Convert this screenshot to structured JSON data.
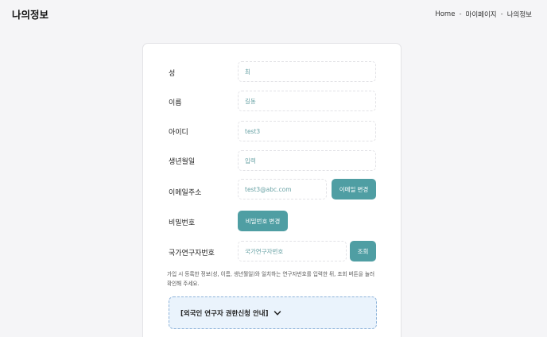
{
  "header": {
    "title": "나의정보",
    "breadcrumb": [
      "Home",
      "마이페이지",
      "나의정보"
    ],
    "separator": "-"
  },
  "form": {
    "rows": [
      {
        "label": "성",
        "value": "최"
      },
      {
        "label": "이름",
        "value": "길동"
      },
      {
        "label": "아이디",
        "value": "test3"
      },
      {
        "label": "생년월일",
        "value": "입력"
      },
      {
        "label": "이메일주소",
        "value": "test3@abc.com"
      },
      {
        "label": "비밀번호",
        "value": ""
      },
      {
        "label": "국가연구자번호",
        "placeholder": "국가연구자번호"
      }
    ],
    "email_change_button": "이메일 변경",
    "password_change_button": "비밀번호 변경",
    "lookup_button": "조회"
  },
  "notice": "가입 시 등록한 정보(성, 이름, 생년월일)와 일치하는 연구자번호를 입력한 뒤, 조회 버튼을 눌러 확인해 주세요.",
  "foreign_box": {
    "label": "[외국인 연구자 권한신청 안내]",
    "icon": "chevron-down-icon"
  },
  "colors": {
    "accent": "#4f9ea3",
    "field_text": "#6aa3a6",
    "info_bg": "#eaf3fc"
  }
}
